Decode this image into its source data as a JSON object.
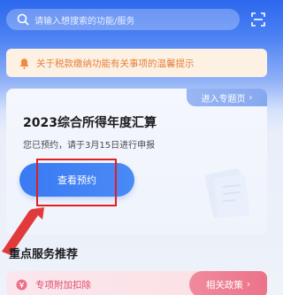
{
  "search": {
    "placeholder": "请输入想搜索的功能/服务"
  },
  "notice": {
    "text": "关于税款缴纳功能有关事项的温馨提示"
  },
  "feature_card": {
    "topic_link": "进入专题页",
    "title": "2023综合所得年度汇算",
    "subtitle": "您已预约，请于3月15日进行申报",
    "button_label": "查看预约"
  },
  "section": {
    "title": "重点服务推荐",
    "items": [
      {
        "label": "专项附加扣除",
        "action": "相关政策"
      }
    ]
  },
  "colors": {
    "header_blue": "#2c68ee",
    "notice_orange": "#e5813b",
    "button_blue": "#3a7af3",
    "annotation_red": "#e02020",
    "service_pink": "#e04b6a"
  },
  "icons": {
    "search": "search-icon",
    "scan": "scan-icon",
    "notice": "bell-icon",
    "topic_chevron": "chevron-right-icon",
    "service": "deduction-icon",
    "policy_chevron": "chevron-right-icon"
  },
  "symbols": {
    "chevron": "›"
  }
}
